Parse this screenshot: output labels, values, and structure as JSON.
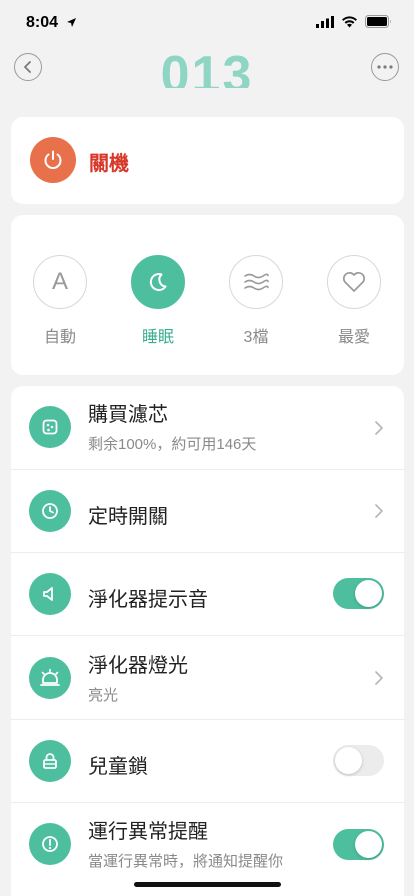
{
  "status_bar": {
    "time": "8:04",
    "icons": [
      "location-arrow-icon",
      "cellular-signal-icon",
      "wifi-icon",
      "battery-icon"
    ]
  },
  "nav": {
    "back_icon": "chevron-left-icon",
    "more_icon": "ellipsis-icon",
    "device_number": "013"
  },
  "power": {
    "label": "關機",
    "icon": "power-icon",
    "color": "#e8704a",
    "label_color": "#d8382a"
  },
  "modes": [
    {
      "label": "自動",
      "glyph": "A",
      "icon": "auto-letter-icon",
      "active": false
    },
    {
      "label": "睡眠",
      "icon": "moon-icon",
      "active": true
    },
    {
      "label": "3檔",
      "icon": "wind-waves-icon",
      "active": false
    },
    {
      "label": "最愛",
      "icon": "heart-icon",
      "active": false
    }
  ],
  "settings": {
    "filter": {
      "title": "購買濾芯",
      "subtitle": "剩余100%，約可用146天",
      "icon": "filter-icon"
    },
    "timer": {
      "title": "定時開關",
      "icon": "clock-icon"
    },
    "sound": {
      "title": "淨化器提示音",
      "icon": "speaker-icon",
      "enabled": true
    },
    "light": {
      "title": "淨化器燈光",
      "subtitle": "亮光",
      "icon": "lamp-icon"
    },
    "child_lock": {
      "title": "兒童鎖",
      "icon": "lock-icon",
      "enabled": false
    },
    "alert": {
      "title": "運行異常提醒",
      "subtitle": "當運行異常時，將通知提醒你",
      "icon": "alert-icon",
      "enabled": true
    }
  },
  "colors": {
    "accent": "#4dbf9f",
    "background": "#f2f2f2"
  }
}
